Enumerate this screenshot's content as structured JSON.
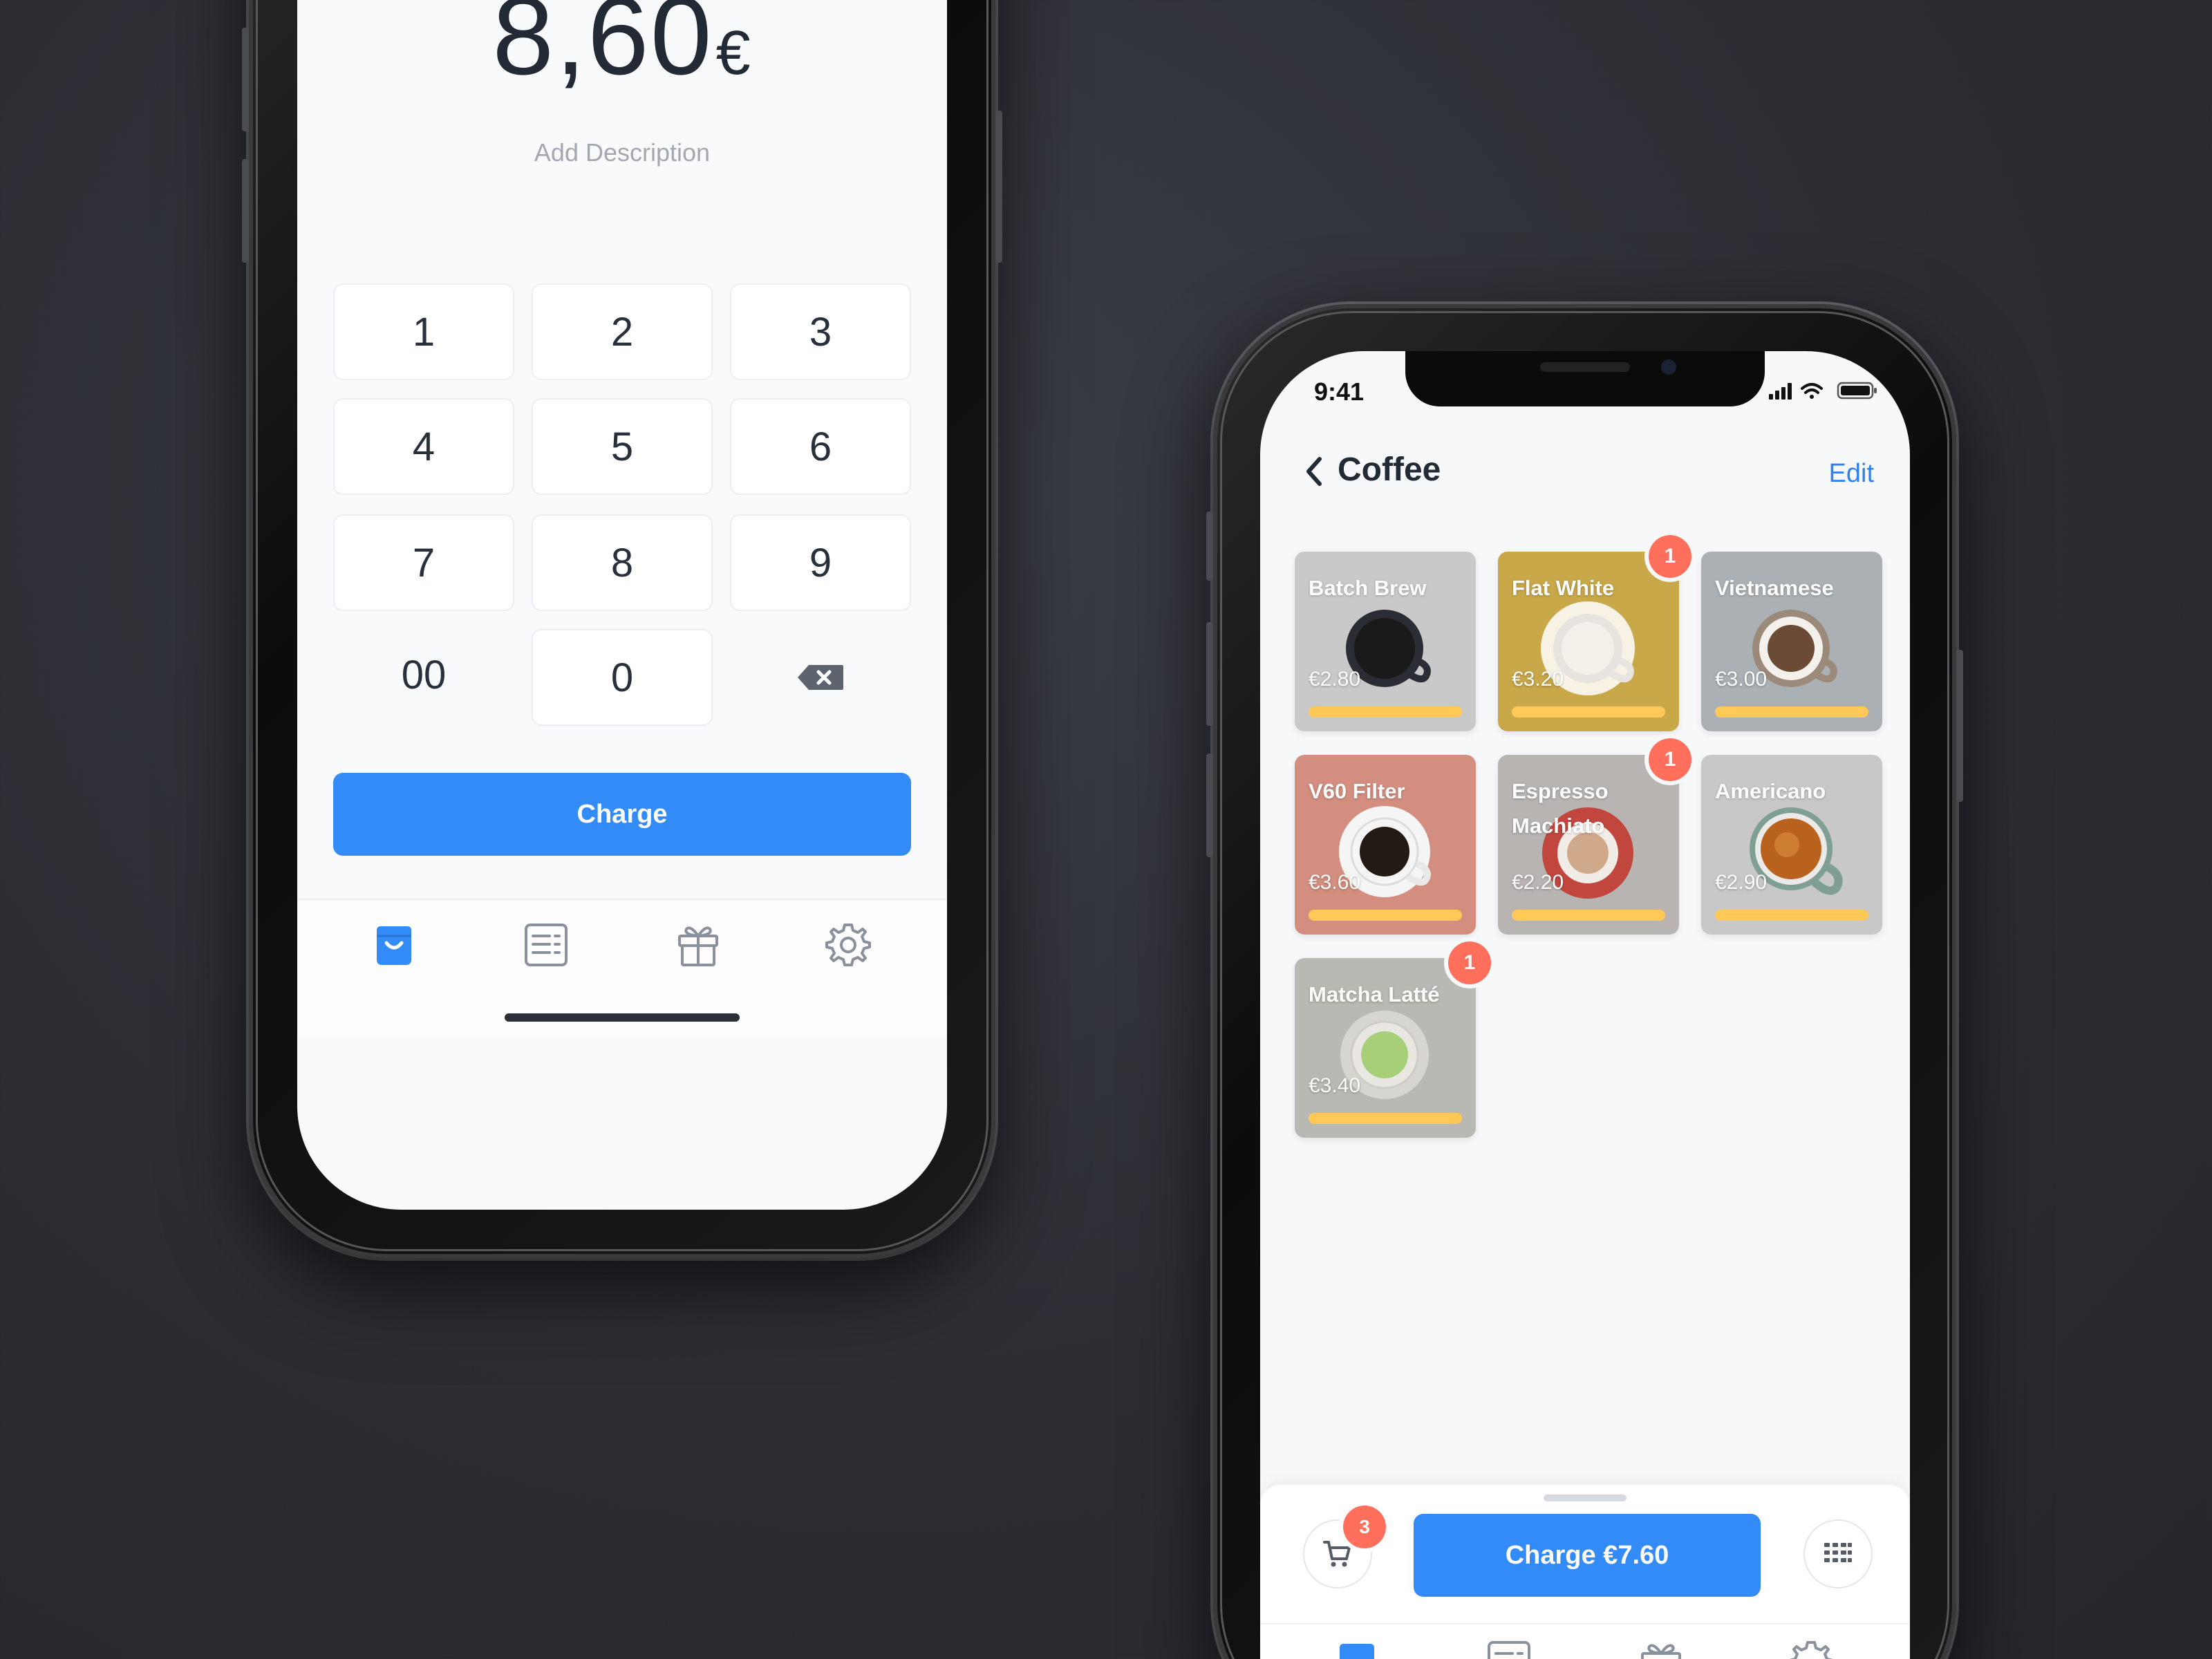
{
  "keypad_screen": {
    "amount": "8,60",
    "currency": "€",
    "description_placeholder": "Add Description",
    "keys": [
      "1",
      "2",
      "3",
      "4",
      "5",
      "6",
      "7",
      "8",
      "9",
      "00",
      "0"
    ],
    "charge_label": "Charge",
    "tabs": [
      "shopping-bag-icon",
      "receipt-icon",
      "gift-icon",
      "gear-icon"
    ]
  },
  "menu_screen": {
    "status_time": "9:41",
    "title": "Coffee",
    "edit_label": "Edit",
    "products": [
      {
        "name": "Batch Brew",
        "price": "€2.80",
        "color": "#c9c9c9",
        "cup": "#1a1a1a",
        "rim": "#2a2d33",
        "badge": ""
      },
      {
        "name": "Flat White",
        "price": "€3.20",
        "color": "#c9a84a",
        "cup": "#f3f0ea",
        "rim": "#e7e4df",
        "badge": "1"
      },
      {
        "name": "Vietnamese",
        "price": "€3.00",
        "color": "#aab0b4",
        "cup": "#6b4a36",
        "rim": "#9b8a7a",
        "badge": ""
      },
      {
        "name": "V60 Filter",
        "price": "€3.60",
        "color": "#d48e7f",
        "cup": "#231a14",
        "rim": "#f5f5f5",
        "badge": ""
      },
      {
        "name": "Espresso Machiato",
        "price": "€2.20",
        "color": "#b7b4b2",
        "cup": "#cfa98a",
        "rim": "#c0463e",
        "badge": "1"
      },
      {
        "name": "Americano",
        "price": "€2.90",
        "color": "#c8c8c8",
        "cup": "#b8621e",
        "rim": "#7f9f95",
        "badge": ""
      },
      {
        "name": "Matcha Latté",
        "price": "€3.40",
        "color": "#b8b9b2",
        "cup": "#a6cf78",
        "rim": "#e9e7e2",
        "badge": "1"
      }
    ],
    "cart_count": "3",
    "charge_label": "Charge €7.60",
    "colors": {
      "accent": "#338bf8",
      "badge": "#ff6f5b",
      "progress": "#ffc857"
    }
  }
}
